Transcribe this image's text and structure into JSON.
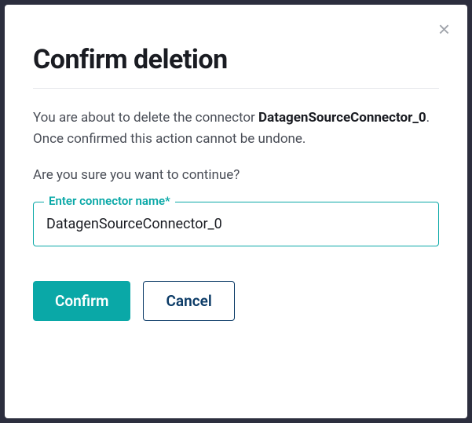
{
  "modal": {
    "title": "Confirm deletion",
    "body_prefix": "You are about to delete the connector ",
    "connector_name": "DatagenSourceConnector_0",
    "body_suffix": ". Once confirmed this action cannot be undone.",
    "prompt": "Are you sure you want to continue?",
    "field_label": "Enter connector name*",
    "field_value": "DatagenSourceConnector_0",
    "confirm_label": "Confirm",
    "cancel_label": "Cancel"
  },
  "colors": {
    "accent": "#0aa8a7",
    "cancel_border": "#0a3a66"
  }
}
